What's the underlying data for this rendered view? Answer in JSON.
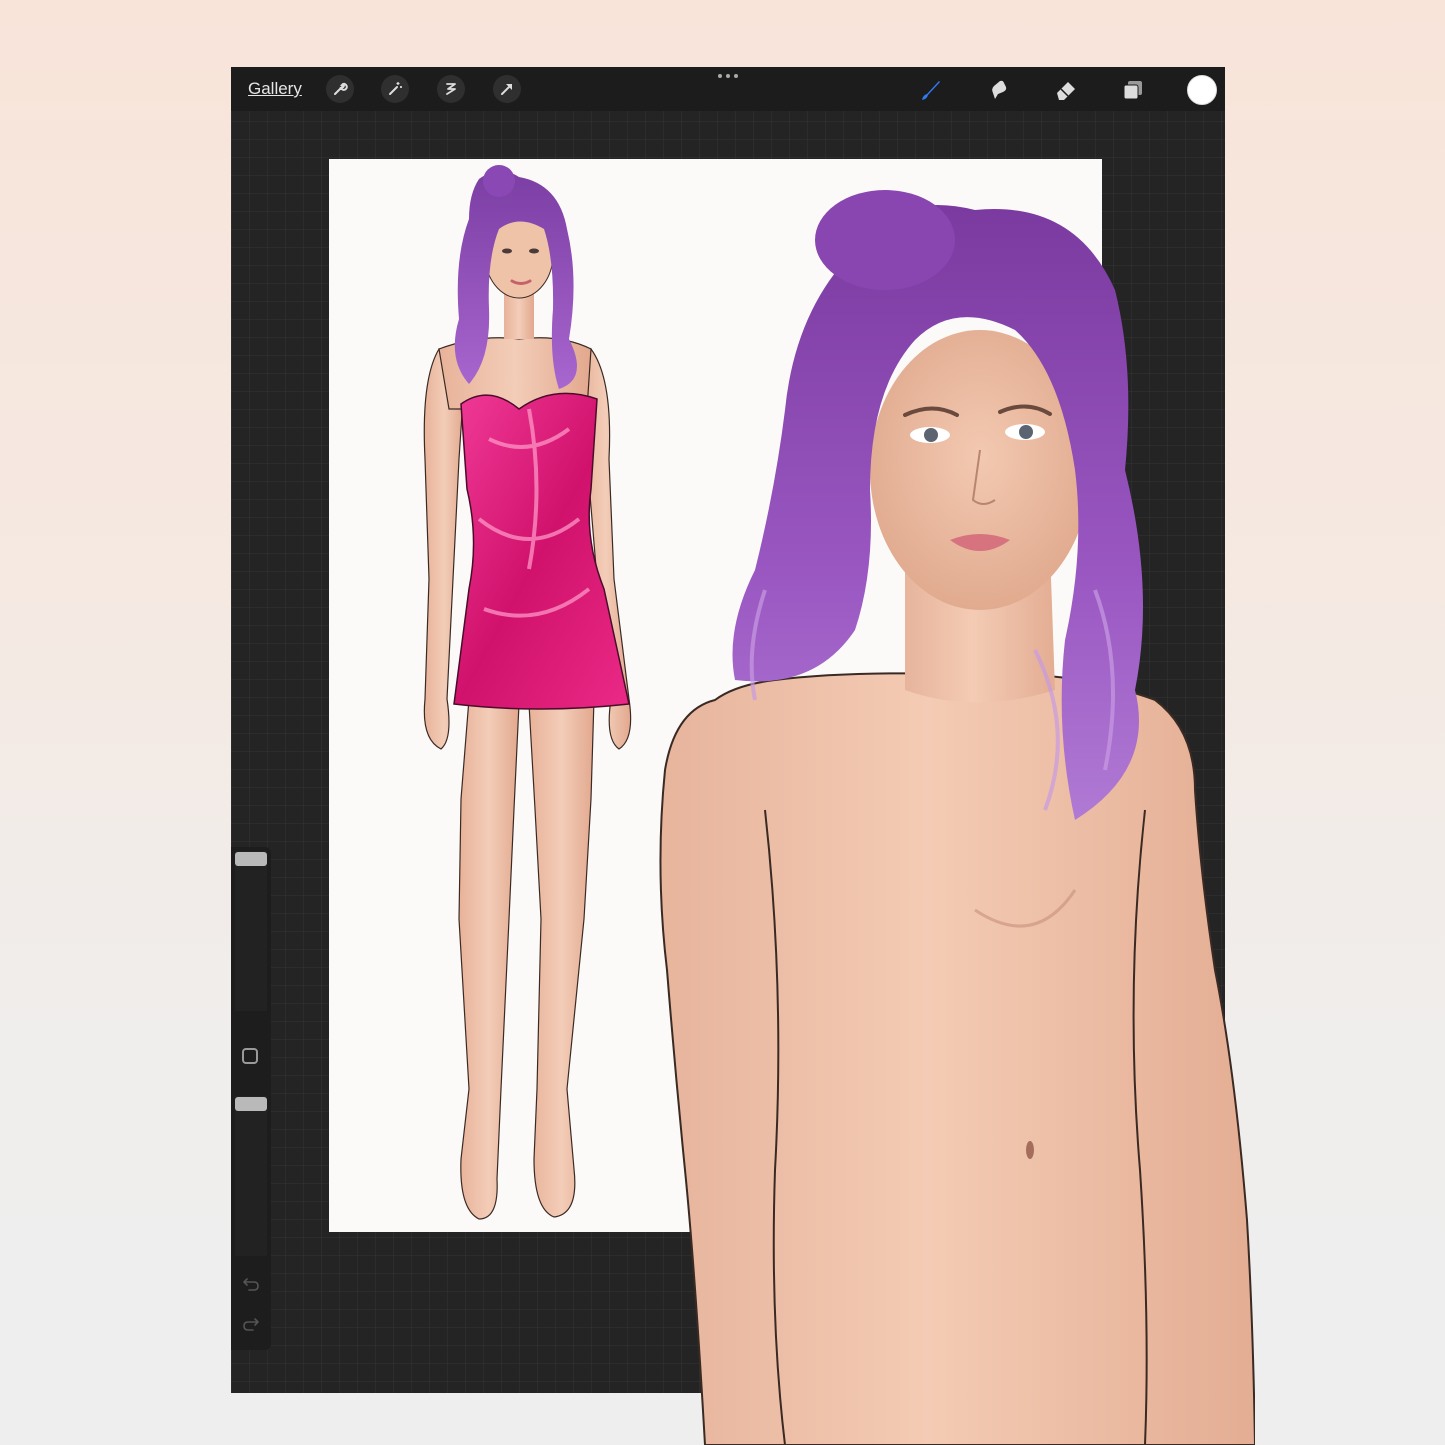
{
  "toolbar": {
    "gallery_label": "Gallery",
    "left_tools": [
      "wrench-icon",
      "magic-wand-icon",
      "selection-icon",
      "transform-arrow-icon"
    ],
    "right_tools": [
      "brush-icon",
      "smudge-icon",
      "eraser-icon",
      "layers-icon"
    ],
    "active_tool": "brush-icon",
    "active_color": "#ffffff",
    "accent_color": "#2f7bf0"
  },
  "sidebar": {
    "brush_size": 0.96,
    "opacity": 0.97,
    "modify_icon": "square-icon",
    "undo_icon": "undo-arrow-icon",
    "redo_icon": "redo-arrow-icon"
  },
  "artwork": {
    "hair_color": "#9b5bc4",
    "dress_color": "#e0187a",
    "skin_color": "#efc0a6"
  }
}
